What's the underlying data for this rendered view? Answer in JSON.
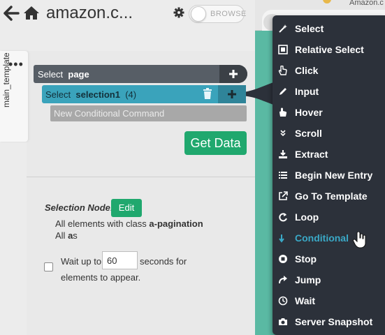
{
  "browser": {
    "tab_title": "Amazon.c"
  },
  "header": {
    "title": "amazon.c...",
    "toggle_label": "BROWSE"
  },
  "template_tab": {
    "label": "main_template",
    "dots": "•••"
  },
  "commands": {
    "page": {
      "prefix": "Select",
      "name": "page"
    },
    "selection": {
      "prefix": "Select",
      "name": "selection1",
      "count": "(4)"
    },
    "conditional": {
      "label": "New Conditional Command"
    }
  },
  "get_data_label": "Get Data",
  "selection_node": {
    "label": "Selection Node:",
    "edit_label": "Edit",
    "line1_prefix": "All elements with class ",
    "line1_bold": "a-pagination",
    "line2_prefix": "All ",
    "line2_bold": "a",
    "line2_suffix": "s"
  },
  "wait": {
    "prefix": "Wait up to",
    "value": "60",
    "suffix": "seconds for",
    "line2": "elements to appear."
  },
  "menu": {
    "items": [
      {
        "label": "Select",
        "icon": "magic-wand-icon"
      },
      {
        "label": "Relative Select",
        "icon": "relative-select-icon"
      },
      {
        "label": "Click",
        "icon": "pointer-hand-icon"
      },
      {
        "label": "Input",
        "icon": "pencil-icon"
      },
      {
        "label": "Hover",
        "icon": "hover-hand-icon"
      },
      {
        "label": "Scroll",
        "icon": "double-chevron-down-icon"
      },
      {
        "label": "Extract",
        "icon": "download-icon"
      },
      {
        "label": "Begin New Entry",
        "icon": "list-icon"
      },
      {
        "label": "Go To Template",
        "icon": "external-link-icon"
      },
      {
        "label": "Loop",
        "icon": "loop-icon"
      },
      {
        "label": "Conditional",
        "icon": "branch-arrow-icon"
      },
      {
        "label": "Stop",
        "icon": "stop-icon"
      },
      {
        "label": "Jump",
        "icon": "jump-arrow-icon"
      },
      {
        "label": "Wait",
        "icon": "clock-icon"
      },
      {
        "label": "Server Snapshot",
        "icon": "camera-icon"
      }
    ],
    "active_index": 10
  },
  "colors": {
    "accent_teal": "#3aa3bb",
    "accent_green": "#20a86e",
    "menu_bg": "#2c313a",
    "active_item": "#3aa9c7"
  }
}
